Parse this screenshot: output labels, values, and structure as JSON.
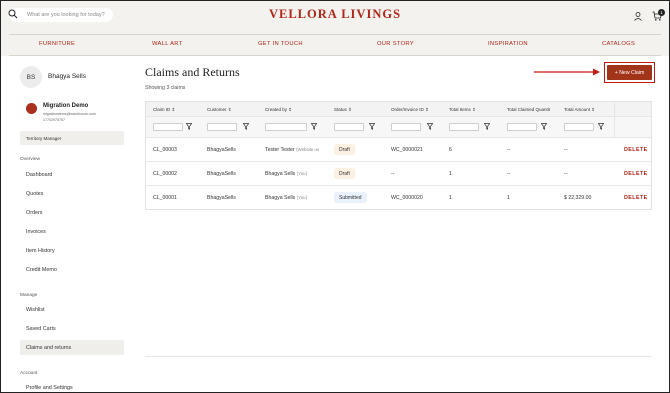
{
  "header": {
    "search_placeholder": "What are you looking for today?",
    "logo": "VELLORA  LIVINGS",
    "cart_count": "1"
  },
  "nav": [
    "FURNITURE",
    "WALL ART",
    "GET IN TOUCH",
    "OUR STORY",
    "INSPIRATION",
    "CATALOGS"
  ],
  "account": {
    "initials": "BS",
    "name": "Bhagya Sells",
    "org_name": "Migration Demo",
    "org_email": "migrationdemo@warehouse.com",
    "org_phone": "17702975767",
    "role": "Territory Manager"
  },
  "sidebar": {
    "overview_label": "Overview",
    "overview": [
      "Dashboard",
      "Quotes",
      "Orders",
      "Invoices",
      "Item History",
      "Credit Memo"
    ],
    "manage_label": "Manage",
    "manage": [
      "Wishlist",
      "Saved Carts",
      "Claims and returns"
    ],
    "account_label": "Account",
    "account": [
      "Profile and Settings"
    ]
  },
  "main": {
    "title": "Claims and Returns",
    "showing": "Showing 3 claims",
    "new_claim": "+ New Claim",
    "columns": [
      "Claim ID",
      "Customer",
      "Created by",
      "Status",
      "Order/Invoice ID",
      "Total Items",
      "Total Claimed Quantit",
      "Total Amount"
    ],
    "rows": [
      {
        "id": "CL_00003",
        "customer": "BhagyaSells",
        "created_by": "Tester Tester",
        "created_note": "(Website us",
        "status": "Draft",
        "order": "WC_0000021",
        "items": "6",
        "claimed": "--",
        "amount": "--",
        "action": "DELETE"
      },
      {
        "id": "CL_00002",
        "customer": "BhagyaSells",
        "created_by": "Bhagya Sells",
        "created_note": "(You)",
        "status": "Draft",
        "order": "--",
        "items": "1",
        "claimed": "--",
        "amount": "--",
        "action": "DELETE"
      },
      {
        "id": "CL_00001",
        "customer": "BhagyaSells",
        "created_by": "Bhagya Sells",
        "created_note": "(You)",
        "status": "Submitted",
        "order": "WC_0000020",
        "items": "1",
        "claimed": "1",
        "amount": "$ 22,329.00",
        "action": "DELETE"
      }
    ]
  },
  "colors": {
    "brand": "#b32519",
    "button": "#a23419",
    "highlight": "#c41b14"
  }
}
